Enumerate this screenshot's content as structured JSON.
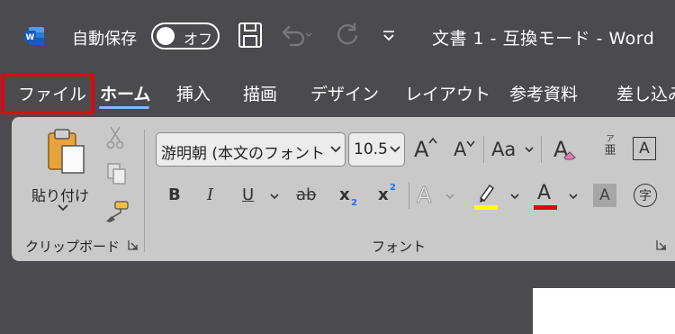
{
  "titlebar": {
    "autosave_label": "自動保存",
    "autosave_state": "オフ",
    "document_title": "文書 1  -  互換モード  -  Word",
    "app_logo_letter": "W"
  },
  "tabs": [
    {
      "label": "ファイル"
    },
    {
      "label": "ホーム"
    },
    {
      "label": "挿入"
    },
    {
      "label": "描画"
    },
    {
      "label": "デザイン"
    },
    {
      "label": "レイアウト"
    },
    {
      "label": "参考資料"
    },
    {
      "label": "差し込み"
    }
  ],
  "clipboard": {
    "paste_label": "貼り付け",
    "group_label": "クリップボード"
  },
  "font": {
    "font_name": "游明朝 (本文のフォント",
    "font_size": "10.5",
    "change_case_label": "Aa",
    "group_label": "フォント",
    "bold": "B",
    "italic": "I",
    "underline": "U",
    "strikethrough": "ab",
    "subscript": "x",
    "superscript": "x",
    "sub_mark": "2",
    "super_mark": "2",
    "grow_font": "A",
    "shrink_font": "A",
    "text_effect": "A",
    "font_color": "A",
    "char_shading": "A",
    "char_border": "A",
    "phonetic_top": "ア",
    "phonetic_bottom": "亜",
    "enclose_char": "字"
  },
  "colors": {
    "highlight": "#ffff00",
    "font_color": "#e60012",
    "annotation": "#e60012",
    "active_tab_underline": "#8ab4f8",
    "word_blue": "#185abd"
  }
}
